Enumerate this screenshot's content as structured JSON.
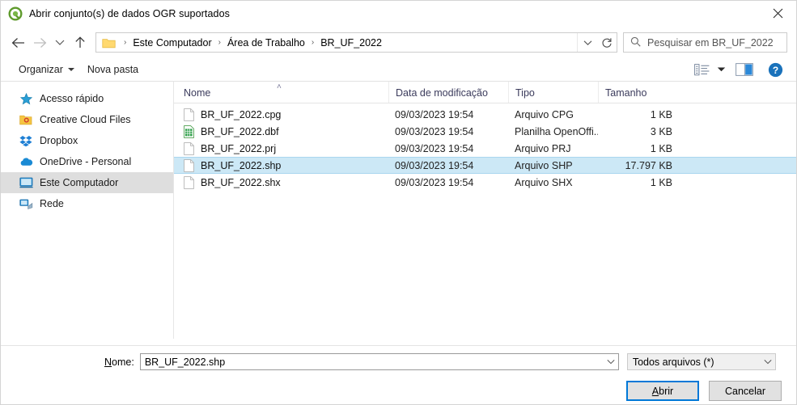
{
  "window": {
    "title": "Abrir conjunto(s) de dados OGR suportados",
    "app_icon": "qgis-logo-icon",
    "close_label": "✕"
  },
  "nav": {
    "back_icon": "arrow-left-icon",
    "forward_icon": "arrow-right-icon",
    "recent_icon": "chevron-down-icon",
    "up_icon": "arrow-up-icon",
    "breadcrumb": [
      "Este Computador",
      "Área de Trabalho",
      "BR_UF_2022"
    ],
    "separator": "›",
    "dropdown_icon": "chevron-down-icon",
    "refresh_icon": "refresh-icon"
  },
  "search": {
    "placeholder": "Pesquisar em BR_UF_2022",
    "icon": "search-icon"
  },
  "toolbar": {
    "organize_label": "Organizar",
    "new_folder_label": "Nova pasta",
    "view_icon": "list-view-icon",
    "view_caret_icon": "chevron-down-icon",
    "preview_icon": "preview-pane-icon",
    "help_icon": "help-circle-icon"
  },
  "sidebar": {
    "items": [
      {
        "label": "Acesso rápido",
        "icon": "star-icon",
        "selected": false
      },
      {
        "label": "Creative Cloud Files",
        "icon": "folder-cc-icon",
        "selected": false
      },
      {
        "label": "Dropbox",
        "icon": "dropbox-icon",
        "selected": false
      },
      {
        "label": "OneDrive - Personal",
        "icon": "cloud-icon",
        "selected": false
      },
      {
        "label": "Este Computador",
        "icon": "computer-icon",
        "selected": true
      },
      {
        "label": "Rede",
        "icon": "network-icon",
        "selected": false
      }
    ]
  },
  "file_list": {
    "columns": [
      {
        "key": "name",
        "label": "Nome",
        "sorted": "asc"
      },
      {
        "key": "date",
        "label": "Data de modificação",
        "sorted": ""
      },
      {
        "key": "type",
        "label": "Tipo",
        "sorted": ""
      },
      {
        "key": "size",
        "label": "Tamanho",
        "sorted": ""
      }
    ],
    "sort_caret": "˄",
    "rows": [
      {
        "name": "BR_UF_2022.cpg",
        "date": "09/03/2023 19:54",
        "type": "Arquivo CPG",
        "size": "1 KB",
        "icon": "generic-file-icon",
        "selected": false
      },
      {
        "name": "BR_UF_2022.dbf",
        "date": "09/03/2023 19:54",
        "type": "Planilha OpenOffi...",
        "size": "3 KB",
        "icon": "spreadsheet-file-icon",
        "selected": false
      },
      {
        "name": "BR_UF_2022.prj",
        "date": "09/03/2023 19:54",
        "type": "Arquivo PRJ",
        "size": "1 KB",
        "icon": "generic-file-icon",
        "selected": false
      },
      {
        "name": "BR_UF_2022.shp",
        "date": "09/03/2023 19:54",
        "type": "Arquivo SHP",
        "size": "17.797 KB",
        "icon": "generic-file-icon",
        "selected": true
      },
      {
        "name": "BR_UF_2022.shx",
        "date": "09/03/2023 19:54",
        "type": "Arquivo SHX",
        "size": "1 KB",
        "icon": "generic-file-icon",
        "selected": false
      }
    ]
  },
  "footer": {
    "name_label_prefix": "N",
    "name_label_rest": "ome:",
    "name_value": "BR_UF_2022.shp",
    "filter_value": "Todos arquivos (*)",
    "open_prefix": "A",
    "open_rest": "brir",
    "cancel_label": "Cancelar"
  },
  "colors": {
    "accent": "#0078d7",
    "selection": "#cce8f6",
    "sidebar_selection": "#dedede",
    "qgis_green": "#589632"
  }
}
